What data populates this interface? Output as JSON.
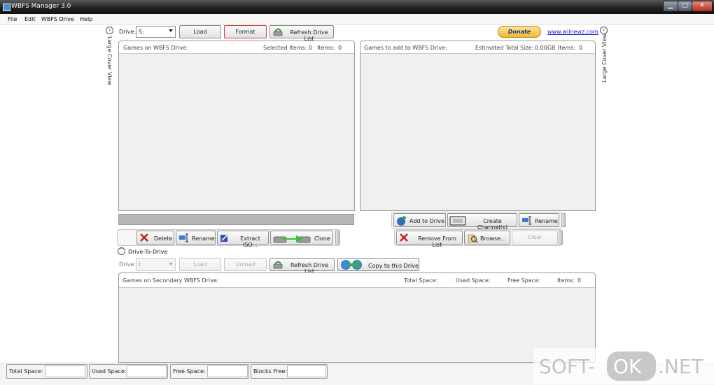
{
  "window": {
    "title": "WBFS Manager 3.0",
    "min": "▁",
    "max": "□",
    "close": "✕"
  },
  "menu": [
    "File",
    "Edit",
    "WBFS Drive",
    "Help"
  ],
  "toolbar": {
    "drive_label": "Drive:",
    "drive_value": "S:",
    "load": "Load",
    "format": "Format",
    "refresh": "Refresh Drive List",
    "donate": "Donate",
    "link": "www.wiinewz.com"
  },
  "side": {
    "left": "Large Cover View",
    "right": "Large Cover View",
    "left_arrow": "›",
    "right_arrow": "‹"
  },
  "wbfs_panel": {
    "title": "Games on WBFS Drive:",
    "selected_label": "Selected Items:",
    "selected_value": "0",
    "items_label": "Items:",
    "items_value": "0"
  },
  "add_panel": {
    "title": "Games to add to WBFS Drive:",
    "size_label": "Estimated Total Size:",
    "size_value": "0.00GB",
    "items_label": "Items:",
    "items_value": "0"
  },
  "left_actions": {
    "delete": "Delete",
    "rename": "Rename",
    "extract": "Extract ISO...",
    "clone": "Clone"
  },
  "right_actions": {
    "add": "Add to Drive",
    "channel": "Create Channel(s)",
    "rename": "Rename",
    "remove": "Remove From List",
    "browse": "Browse...",
    "clear": "Clear"
  },
  "drive_to_drive": {
    "title": "Drive-To-Drive",
    "toggle": "˄",
    "drive_label": "Drive:",
    "drive_value": "I:",
    "load": "Load",
    "unload": "Unload",
    "refresh": "Refresh Drive List",
    "copy": "Copy to this Drive"
  },
  "secondary_panel": {
    "title": "Games on Secondary WBFS Drive:",
    "total": "Total Space:",
    "used": "Used Space:",
    "free": "Free Space:",
    "items_label": "Items:",
    "items_value": "0"
  },
  "status": {
    "total": "Total Space:",
    "used": "Used Space:",
    "free": "Free Space:",
    "blocks": "Blocks Free:"
  },
  "watermark": {
    "left": "SOFT-",
    "mid": "OK",
    "right": ".NET"
  }
}
